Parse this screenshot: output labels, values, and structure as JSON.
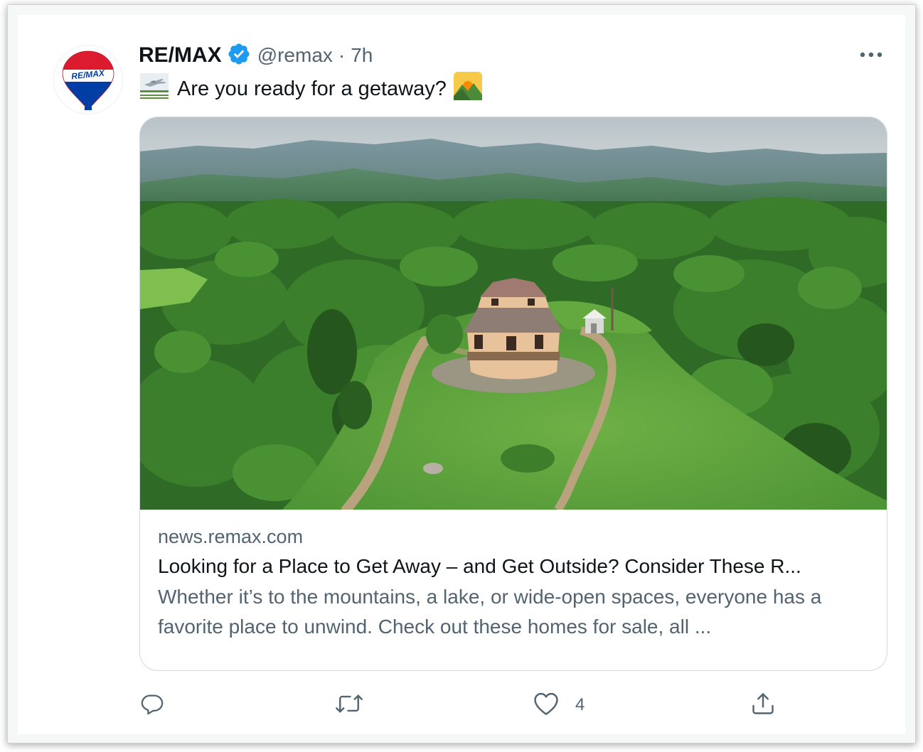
{
  "tweet": {
    "author_name": "RE/MAX",
    "handle": "@remax",
    "separator": "·",
    "time": "7h",
    "text": "Are you ready for a getaway?",
    "icons": {
      "verified": "verified-badge-icon",
      "leading_emoji": "airplane-departure-emoji",
      "trailing_emoji": "sunrise-over-mountains-emoji",
      "more": "more-options-icon"
    },
    "avatar_logo_text": "RE/MAX"
  },
  "card": {
    "domain": "news.remax.com",
    "title": "Looking for a Place to Get Away – and Get Outside? Consider These R...",
    "description": "Whether it’s to the mountains, a lake, or wide-open spaces, everyone has a favorite place to unwind. Check out these homes for sale, all ...",
    "image": "aerial-photo-octagonal-house-in-forest-with-mountains"
  },
  "actions": {
    "reply_icon": "reply-icon",
    "retweet_icon": "retweet-icon",
    "like_icon": "heart-icon",
    "like_count": "4",
    "share_icon": "share-icon"
  },
  "colors": {
    "text_primary": "#0f1419",
    "text_secondary": "#536471",
    "verified_blue": "#1d9bf0",
    "card_border": "#cfd9de",
    "remax_red": "#dc1c2e",
    "remax_blue": "#003da5"
  }
}
